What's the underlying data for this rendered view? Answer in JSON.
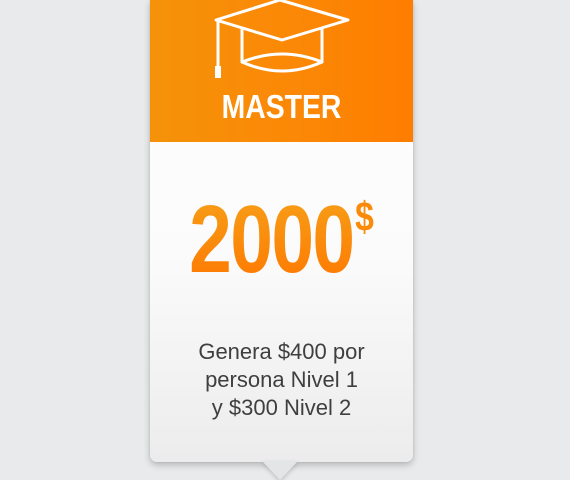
{
  "pricing_card": {
    "icon": "graduation-cap-icon",
    "plan_name": "MASTER",
    "price_amount": "2000",
    "price_currency": "$",
    "description_lines": [
      "Genera $400 por",
      "persona Nivel 1",
      "y $300 Nivel 2"
    ]
  },
  "colors": {
    "accent_orange": "#fb8806",
    "background": "#e9eaeb",
    "text_dark": "#3f3f3f",
    "header_text": "#ffffff"
  }
}
